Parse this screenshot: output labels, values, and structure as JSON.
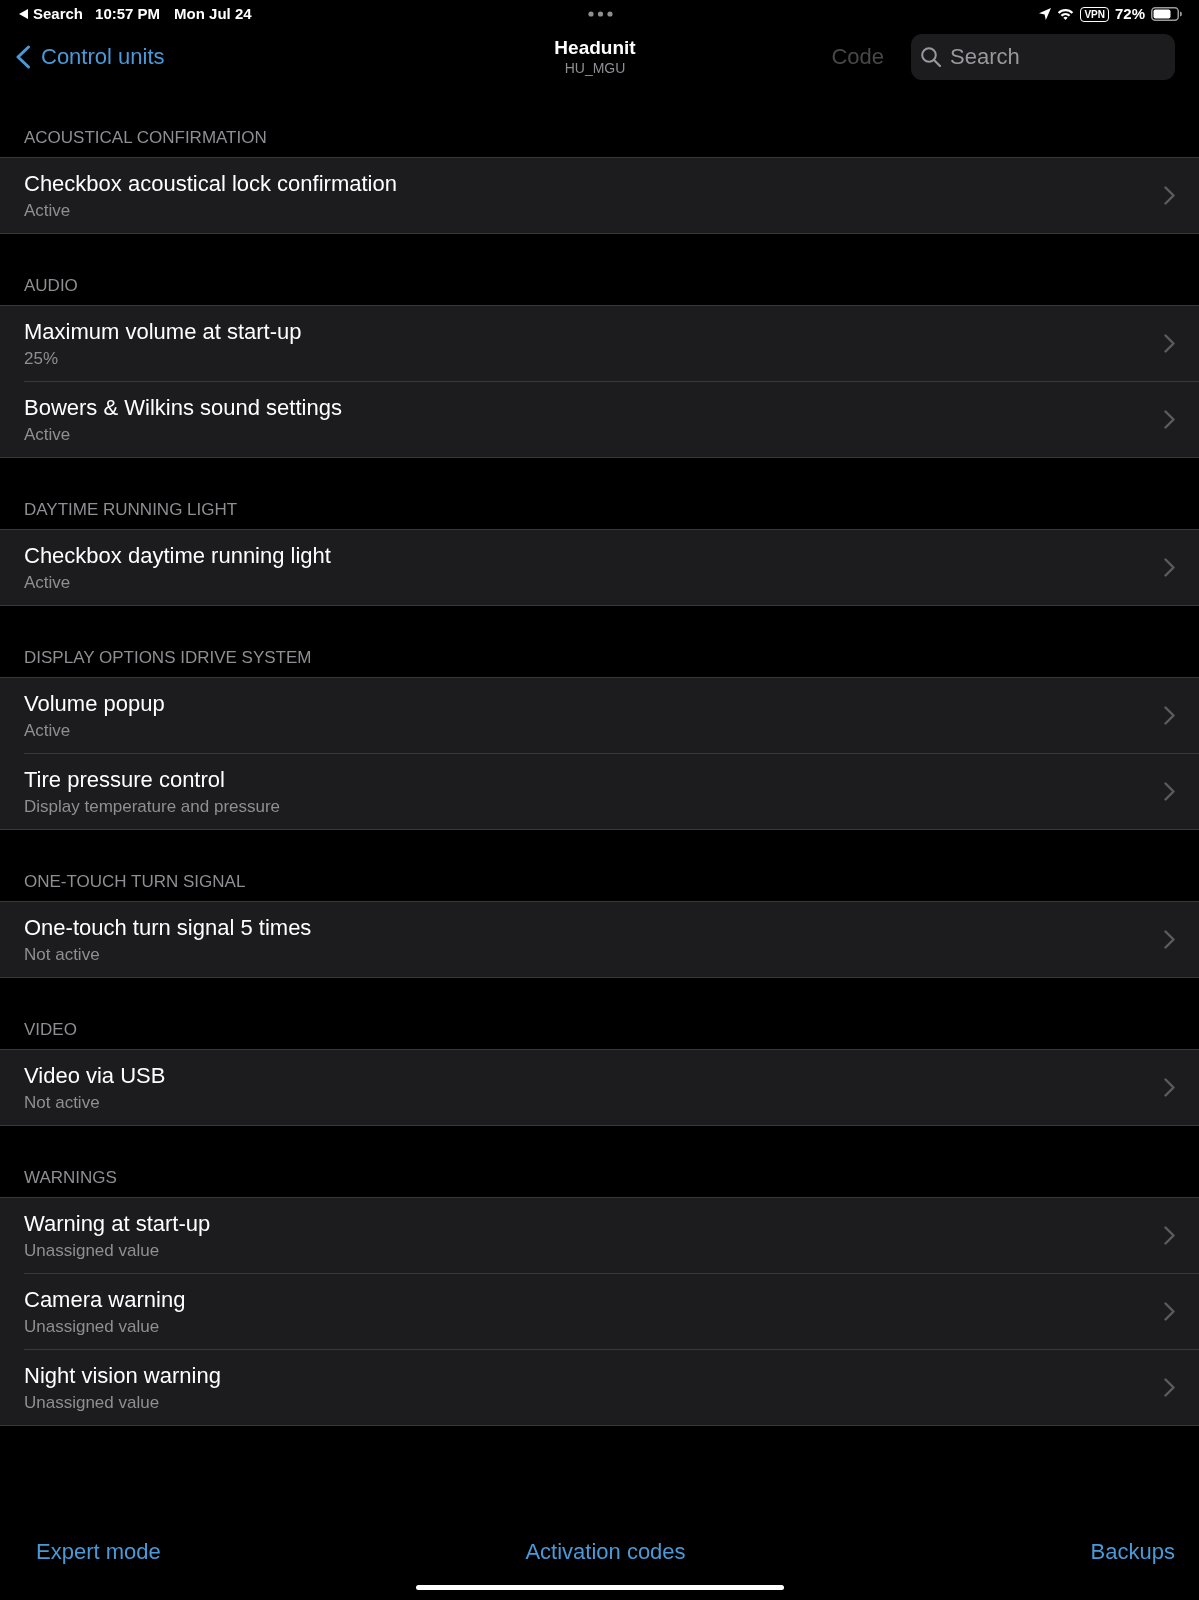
{
  "status_bar": {
    "back_app": "Search",
    "time": "10:57 PM",
    "date": "Mon Jul 24",
    "vpn": "VPN",
    "battery": "72%"
  },
  "nav": {
    "back": "Control units",
    "title": "Headunit",
    "subtitle": "HU_MGU",
    "code_button": {
      "label": "Code",
      "disabled": true
    },
    "search": {
      "placeholder": "Search"
    }
  },
  "sections": [
    {
      "header": "ACOUSTICAL CONFIRMATION",
      "rows": [
        {
          "title": "Checkbox acoustical lock confirmation",
          "value": "Active"
        }
      ]
    },
    {
      "header": "AUDIO",
      "rows": [
        {
          "title": "Maximum volume at start-up",
          "value": "25%"
        },
        {
          "title": "Bowers & Wilkins sound settings",
          "value": "Active"
        }
      ]
    },
    {
      "header": "DAYTIME RUNNING LIGHT",
      "rows": [
        {
          "title": "Checkbox daytime running light",
          "value": "Active"
        }
      ]
    },
    {
      "header": "DISPLAY OPTIONS IDRIVE SYSTEM",
      "rows": [
        {
          "title": "Volume popup",
          "value": "Active"
        },
        {
          "title": "Tire pressure control",
          "value": "Display temperature and pressure"
        }
      ]
    },
    {
      "header": "ONE-TOUCH TURN SIGNAL",
      "rows": [
        {
          "title": "One-touch turn signal 5 times",
          "value": "Not active"
        }
      ]
    },
    {
      "header": "VIDEO",
      "rows": [
        {
          "title": "Video via USB",
          "value": "Not active"
        }
      ]
    },
    {
      "header": "WARNINGS",
      "rows": [
        {
          "title": "Warning at start-up",
          "value": "Unassigned value"
        },
        {
          "title": "Camera warning",
          "value": "Unassigned value"
        },
        {
          "title": "Night vision warning",
          "value": "Unassigned value"
        }
      ]
    }
  ],
  "toolbar": [
    "Expert mode",
    "Activation codes",
    "Backups"
  ]
}
